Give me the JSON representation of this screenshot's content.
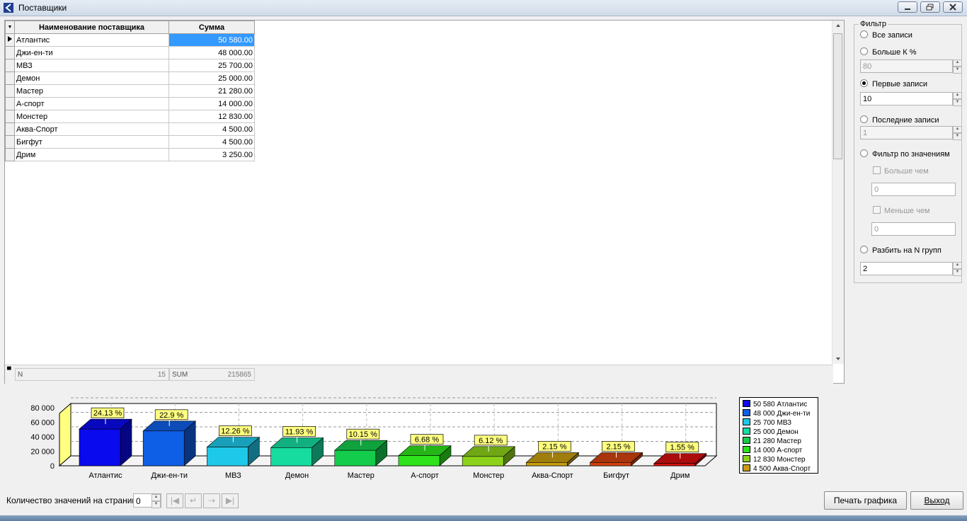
{
  "window": {
    "title": "Поставщики"
  },
  "grid": {
    "columns": [
      "Наименование поставщика",
      "Сумма"
    ],
    "rows": [
      {
        "name": "Атлантис",
        "sum": "50 580.00"
      },
      {
        "name": "Джи-ен-ти",
        "sum": "48 000.00"
      },
      {
        "name": "МВЗ",
        "sum": "25 700.00"
      },
      {
        "name": "Демон",
        "sum": "25 000.00"
      },
      {
        "name": "Мастер",
        "sum": "21 280.00"
      },
      {
        "name": "А-спорт",
        "sum": "14 000.00"
      },
      {
        "name": "Монстер",
        "sum": "12 830.00"
      },
      {
        "name": "Аква-Спорт",
        "sum": "4 500.00"
      },
      {
        "name": "Бигфут",
        "sum": "4 500.00"
      },
      {
        "name": "Дрим",
        "sum": "3 250.00"
      }
    ],
    "footer": {
      "count_label": "N",
      "count_value": "15",
      "sum_label": "SUM",
      "sum_value": "215865"
    }
  },
  "filter": {
    "legend": "Фильтр",
    "all_records": "Все записи",
    "greater_k": "Больше К %",
    "greater_k_value": "80",
    "first_records": "Первые записи",
    "first_records_value": "10",
    "last_records": "Последние записи",
    "last_records_value": "1",
    "filter_by_values": "Фильтр по значениям",
    "greater_than": "Больше чем",
    "greater_than_value": "0",
    "less_than": "Меньше чем",
    "less_than_value": "0",
    "split_groups": "Разбить на N групп",
    "split_groups_value": "2",
    "selected": "first_records"
  },
  "chart_data": {
    "type": "bar",
    "categories": [
      "Атлантис",
      "Джи-ен-ти",
      "МВЗ",
      "Демон",
      "Мастер",
      "А-спорт",
      "Монстер",
      "Аква-Спорт",
      "Бигфут",
      "Дрим"
    ],
    "values": [
      50580,
      48000,
      25700,
      25000,
      21280,
      14000,
      12830,
      4500,
      4500,
      3250
    ],
    "percent_labels": [
      "24.13 %",
      "22.9 %",
      "12.26 %",
      "11.93 %",
      "10.15 %",
      "6.68 %",
      "6.12 %",
      "2.15 %",
      "2.15 %",
      "1.55 %"
    ],
    "colors": [
      "#0a0aee",
      "#0f5ee6",
      "#1ec8e8",
      "#16dca0",
      "#14cc4c",
      "#2ee21c",
      "#8cd21a",
      "#c89e10",
      "#d2420e",
      "#d4100e"
    ],
    "yticks": [
      "80 000",
      "60 000",
      "40 000",
      "20 000",
      "0"
    ],
    "ylim": [
      0,
      80000
    ],
    "grid": true,
    "legend": [
      "50 580 Атлантис",
      "48 000 Джи-ен-ти",
      "25 700 МВЗ",
      "25 000 Демон",
      "21 280 Мастер",
      "14 000 А-спорт",
      "12 830 Монстер",
      "4 500 Аква-Спорт"
    ],
    "legend_placement": "right"
  },
  "bottom": {
    "page_label": "Количество значений на странице",
    "page_value": "0",
    "print_button": "Печать графика",
    "exit_button": "Выход"
  }
}
